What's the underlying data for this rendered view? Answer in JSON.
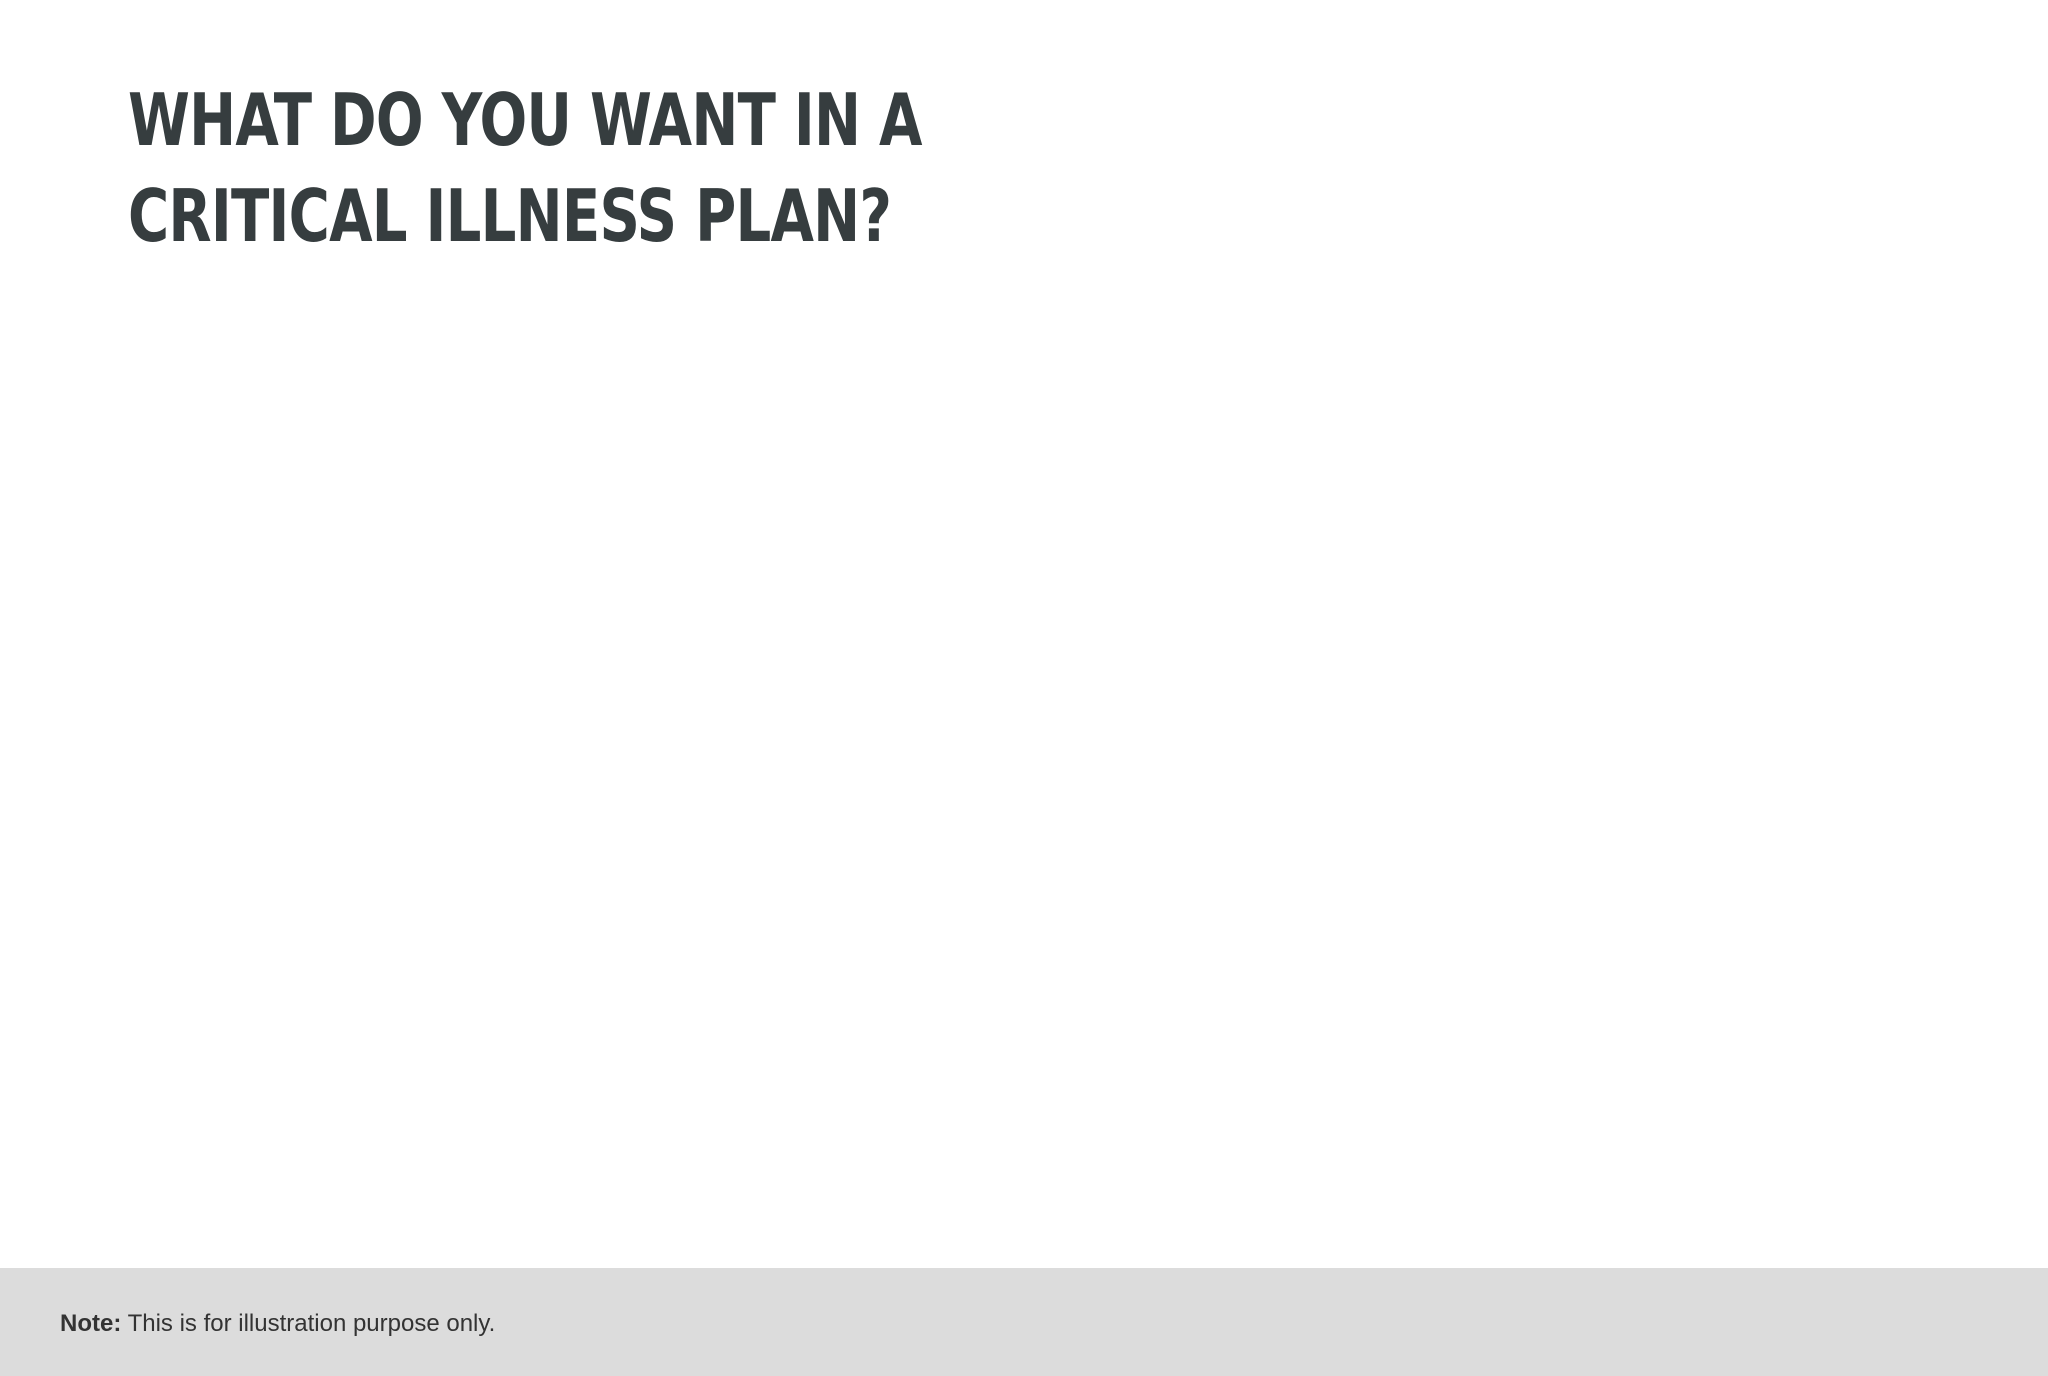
{
  "heading": {
    "line1": "WHAT DO YOU WANT IN A",
    "line2": "CRITICAL ILLNESS PLAN?"
  },
  "footer": {
    "note_label": "Note:",
    "note_text": " This is for illustration purpose only."
  },
  "colors": {
    "heading": "#363d3f",
    "footer_background": "#dcdcdc",
    "footer_text": "#333333"
  }
}
